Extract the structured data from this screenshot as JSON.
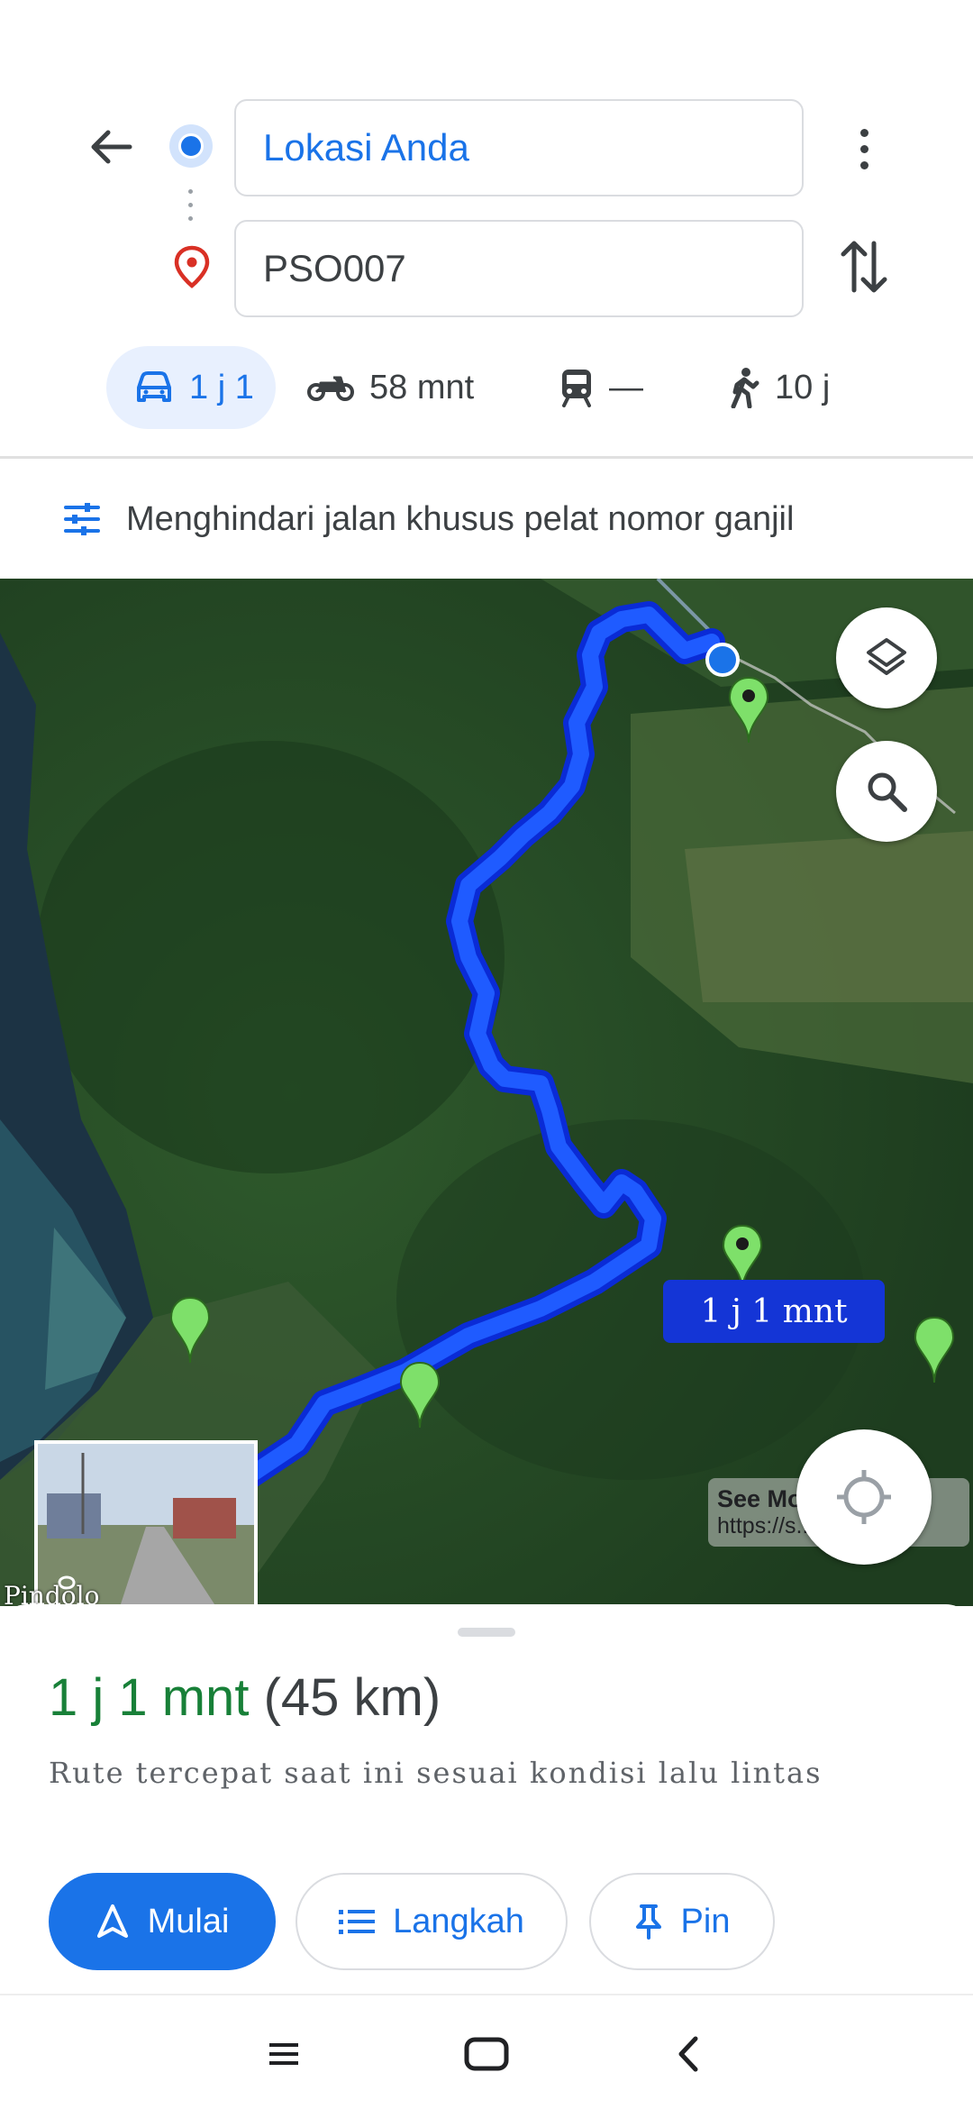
{
  "directions": {
    "origin": "Lokasi Anda",
    "destination": "PSO007"
  },
  "modes": [
    {
      "id": "car",
      "label": "1 j 1",
      "active": true
    },
    {
      "id": "motorcycle",
      "label": "58 mnt",
      "active": false
    },
    {
      "id": "transit",
      "label": "—",
      "active": false
    },
    {
      "id": "walk",
      "label": "10 j",
      "active": false
    }
  ],
  "options": {
    "label": "Menghindari jalan khusus pelat nomor ganjil"
  },
  "map": {
    "eta_chip": "1 j 1 mnt",
    "see_more_title": "See More",
    "see_more_url": "https://s...App/Home",
    "place_label": "Pindolo",
    "route_color": "#1a3cff"
  },
  "summary": {
    "duration": "1 j 1 mnt",
    "distance": "(45 km)",
    "subtitle": "Rute tercepat saat ini sesuai kondisi lalu lintas"
  },
  "actions": {
    "start": "Mulai",
    "steps": "Langkah",
    "pin": "Pin"
  },
  "colors": {
    "accent": "#1a73e8",
    "duration_green": "#188038",
    "active_mode_bg": "#e8f0fe",
    "destination_red": "#d93025"
  }
}
